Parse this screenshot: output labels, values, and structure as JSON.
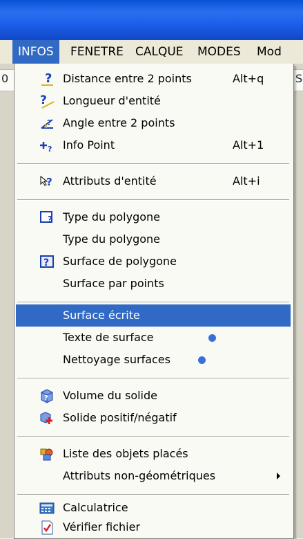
{
  "menubar": {
    "items": [
      {
        "label": "INFOS"
      },
      {
        "label": "FENETRE"
      },
      {
        "label": "CALQUE"
      },
      {
        "label": "MODES"
      },
      {
        "label": "Mod"
      }
    ]
  },
  "edges": {
    "left_char": "0",
    "right_char": "S"
  },
  "menu": {
    "distance": {
      "label": "Distance entre 2 points",
      "shortcut": "Alt+q"
    },
    "longueur": {
      "label": "Longueur d'entité"
    },
    "angle": {
      "label": "Angle entre 2 points"
    },
    "info_point": {
      "label": "Info Point",
      "shortcut": "Alt+1"
    },
    "attributs": {
      "label": "Attributs d'entité",
      "shortcut": "Alt+i"
    },
    "type_polygone_1": {
      "label": "Type du polygone"
    },
    "type_polygone_2": {
      "label": "Type du polygone"
    },
    "surface_polygone": {
      "label": "Surface de polygone"
    },
    "surface_points": {
      "label": "Surface par points"
    },
    "surface_ecrite": {
      "label": "Surface écrite"
    },
    "texte_surface": {
      "label": "Texte de surface"
    },
    "nettoyage": {
      "label": "Nettoyage surfaces"
    },
    "volume": {
      "label": "Volume du solide"
    },
    "solide": {
      "label": "Solide positif/négatif"
    },
    "liste": {
      "label": "Liste des objets placés"
    },
    "attributs_ng": {
      "label": "Attributs non-géométriques"
    },
    "calculatrice": {
      "label": "Calculatrice"
    },
    "verifier": {
      "label": "Vérifier fichier"
    }
  },
  "icons": {
    "highlight_color": "#316ac5",
    "dot_color": "#3a6fd8"
  }
}
